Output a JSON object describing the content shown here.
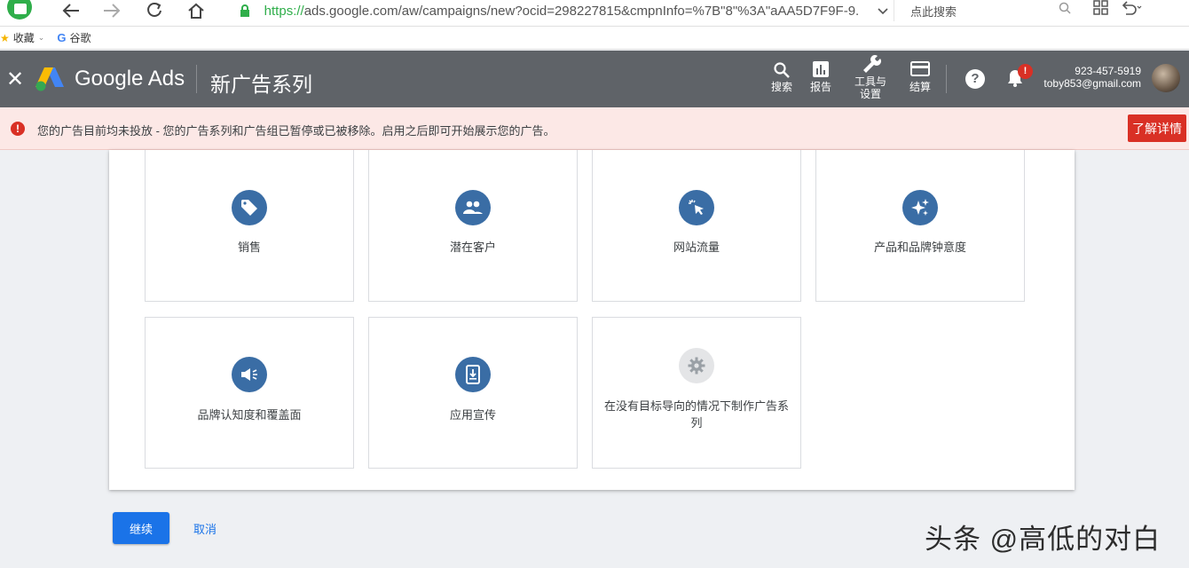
{
  "browser": {
    "url_scheme": "https://",
    "url_rest": "ads.google.com/aw/campaigns/new?ocid=298227815&cmpnInfo=%7B\"8\"%3A\"aAA5D7F9F-9.",
    "search_placeholder": "点此搜索",
    "bookmarks": [
      {
        "label": "收藏",
        "icon": "star-icon"
      },
      {
        "label": "谷歌",
        "icon": "google-g-icon"
      }
    ],
    "logo_color": "#2fae4a"
  },
  "header": {
    "brand": "Google Ads",
    "title": "新广告系列",
    "tools": [
      {
        "label": "搜索",
        "icon": "search-icon"
      },
      {
        "label": "报告",
        "icon": "bar-chart-icon"
      },
      {
        "label": "工具与\n设置",
        "icon": "wrench-icon"
      },
      {
        "label": "结算",
        "icon": "credit-card-icon"
      }
    ],
    "notification_badge": "!",
    "account_id": "923-457-5919",
    "account_email": "toby853@gmail.com",
    "background_color": "#5f6368"
  },
  "alert": {
    "text": "您的广告目前均未投放 - 您的广告系列和广告组已暂停或已被移除。启用之后即可开始展示您的广告。",
    "button_label": "了解详情",
    "background_color": "#fce8e6",
    "accent_color": "#d93025"
  },
  "goals": [
    {
      "label": "销售",
      "icon": "tag-icon"
    },
    {
      "label": "潜在客户",
      "icon": "people-icon"
    },
    {
      "label": "网站流量",
      "icon": "cursor-click-icon"
    },
    {
      "label": "产品和品牌钟意度",
      "icon": "sparkle-icon"
    },
    {
      "label": "品牌认知度和覆盖面",
      "icon": "megaphone-icon"
    },
    {
      "label": "应用宣传",
      "icon": "phone-download-icon"
    },
    {
      "label": "在没有目标导向的情况下制作广告系列",
      "icon": "gear-icon"
    }
  ],
  "actions": {
    "continue_label": "继续",
    "cancel_label": "取消",
    "primary_color": "#1a73e8"
  },
  "watermark": "头条 @高低的对白"
}
